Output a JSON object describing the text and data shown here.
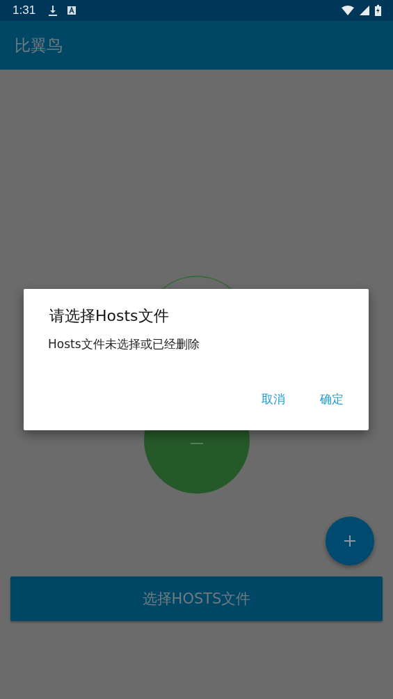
{
  "status_bar": {
    "time": "1:31"
  },
  "app_bar": {
    "title": "比翼鸟"
  },
  "main": {
    "select_button": "选择HOSTS文件"
  },
  "dialog": {
    "title": "请选择Hosts文件",
    "message": "Hosts文件未选择或已经删除",
    "buttons": [
      "取消",
      "确定"
    ]
  }
}
